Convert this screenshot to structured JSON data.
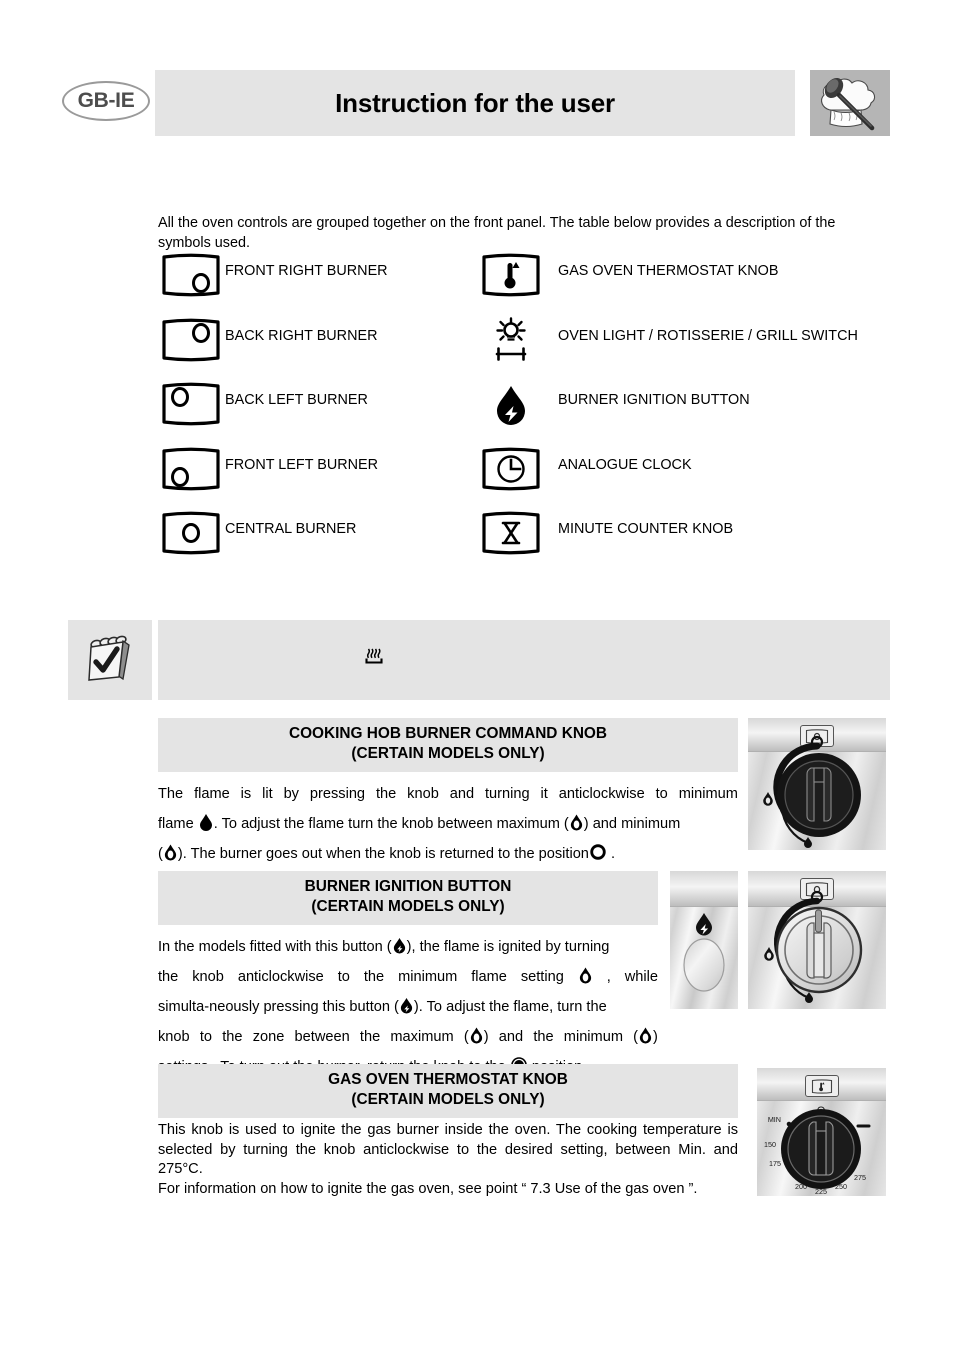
{
  "header": {
    "locale_badge": "GB-IE",
    "title": "Instruction for the user",
    "chef_icon": "chef-hat-spoon-icon"
  },
  "intro": {
    "text": "All the oven controls are grouped together on the front panel. The table below provides a description of the symbols used."
  },
  "symbol_table": {
    "rows": [
      {
        "left_icon": "front-right-burner-icon",
        "left_label": "FRONT RIGHT BURNER",
        "right_icon": "gas-oven-thermostat-icon",
        "right_label": "GAS OVEN THERMOSTAT KNOB"
      },
      {
        "left_icon": "back-right-burner-icon",
        "left_label": "BACK RIGHT BURNER",
        "right_icon": "oven-light-rotisserie-grill-icon",
        "right_label": "OVEN LIGHT / ROTISSERIE / GRILL SWITCH"
      },
      {
        "left_icon": "back-left-burner-icon",
        "left_label": "BACK LEFT BURNER",
        "right_icon": "burner-ignition-flame-icon",
        "right_label": "BURNER IGNITION BUTTON"
      },
      {
        "left_icon": "front-left-burner-icon",
        "left_label": "FRONT LEFT BURNER",
        "right_icon": "analogue-clock-icon",
        "right_label": "ANALOGUE CLOCK"
      },
      {
        "left_icon": "central-burner-icon",
        "left_label": "CENTRAL BURNER",
        "right_icon": "minute-counter-hourglass-icon",
        "right_label": "MINUTE COUNTER KNOB"
      }
    ]
  },
  "note_box": {
    "notepad_icon": "notepad-check-icon",
    "inner_icon": "heating-element-icon",
    "text": ""
  },
  "sections": [
    {
      "id": "hob",
      "heading_line1": "COOKING HOB BURNER COMMAND KNOB",
      "heading_line2": "(CERTAIN MODELS ONLY)",
      "body_lines": [
        [
          "The",
          "flame",
          "is",
          "lit",
          "by",
          "pressing",
          "the",
          "knob",
          "and",
          "turning",
          "it",
          "anticlockwise",
          "to",
          "minimum"
        ],
        [
          "flame  [flame-solid]. To adjust the flame turn the knob between maximum ([flame-outline]) and minimum"
        ],
        [
          "([flame-outline]). The burner goes out when the knob is returned to the position [circle-open] ."
        ]
      ],
      "body_text": "The flame is lit by pressing the knob and turning it anticlockwise to minimum flame . To adjust the flame turn the knob between maximum ( ) and minimum ( ). The burner goes out when the knob is returned to the position .",
      "photo": {
        "name": "cooking-hob-knob-photo",
        "badge_icon": "burner-position-icon",
        "knob_style": "black"
      }
    },
    {
      "id": "ignition",
      "heading_line1": "BURNER IGNITION BUTTON",
      "heading_line2": "(CERTAIN MODELS ONLY)",
      "body_text": "In the models fitted with this button ( ), the flame is ignited by turning the knob anticlockwise to the minimum flame setting , while simulta-neously pressing this button ( ). To adjust the flame, turn the knob to the zone between the maximum ( ) and the minimum ( ) settings. To turn out the burner, return the knob to the position.",
      "photo_button": {
        "name": "ignition-push-button-photo",
        "icon": "burner-ignition-flame-icon"
      },
      "photo": {
        "name": "ignition-knob-photo",
        "badge_icon": "burner-position-icon",
        "knob_style": "silver"
      }
    },
    {
      "id": "thermostat",
      "heading_line1": "GAS OVEN THERMOSTAT KNOB",
      "heading_line2": "(CERTAIN MODELS ONLY)",
      "body_paragraph": "This knob is used to ignite the gas burner inside the oven. The cooking temperature is selected by turning the knob anticlockwise to the desired setting, between Min. and 275°C.",
      "body_paragraph_2": "For information on how to ignite the gas oven, see point “ 7.3 Use of the gas oven ”.",
      "photo": {
        "name": "gas-oven-thermostat-knob-photo",
        "badge_icon": "gas-oven-thermostat-icon",
        "off_label": "O",
        "dial_labels": [
          "MIN",
          "150",
          "175",
          "200",
          "225",
          "250",
          "275"
        ]
      }
    }
  ],
  "colors": {
    "panel_gray": "#e4e4e4",
    "badge_border": "#9a9a9a",
    "chef_bg": "#b5b5b5",
    "text": "#000000"
  }
}
